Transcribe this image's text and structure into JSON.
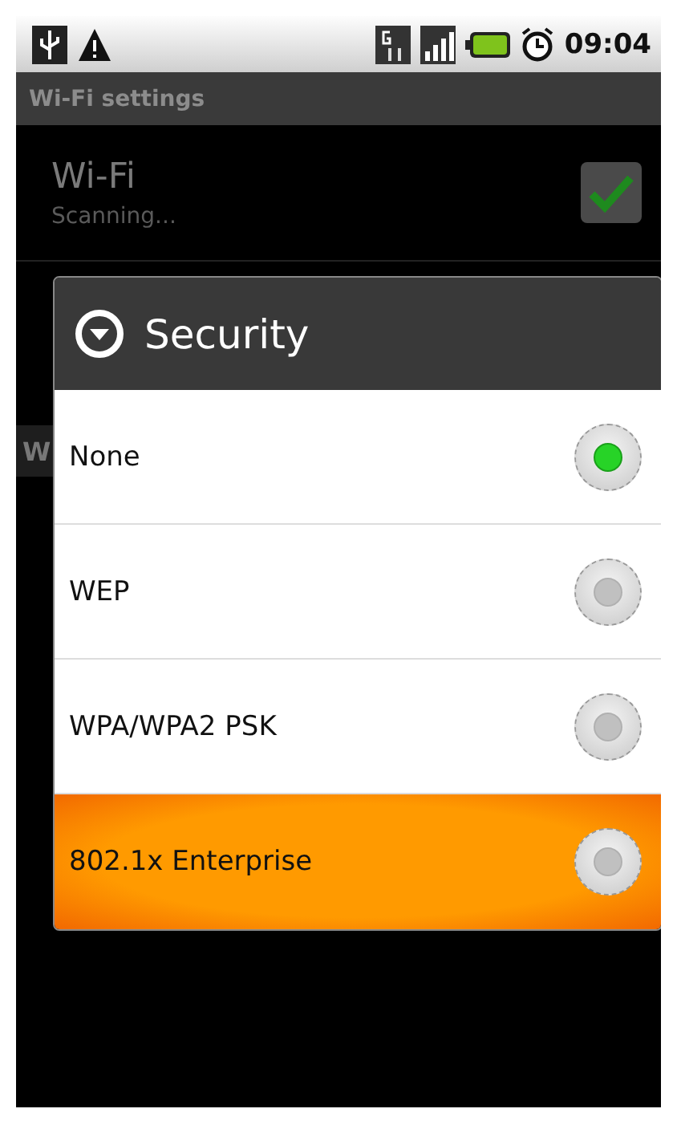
{
  "status_bar": {
    "time": "09:04"
  },
  "title_bar": {
    "title": "Wi-Fi settings"
  },
  "wifi_setting": {
    "title": "Wi-Fi",
    "summary": "Scanning...",
    "checked": true
  },
  "background_items": [
    {
      "kind": "header",
      "label": "W"
    }
  ],
  "dialog": {
    "title": "Security",
    "options": [
      {
        "label": "None",
        "selected": true,
        "pressed": false
      },
      {
        "label": "WEP",
        "selected": false,
        "pressed": false
      },
      {
        "label": "WPA/WPA2 PSK",
        "selected": false,
        "pressed": false
      },
      {
        "label": "802.1x Enterprise",
        "selected": false,
        "pressed": true
      }
    ]
  }
}
